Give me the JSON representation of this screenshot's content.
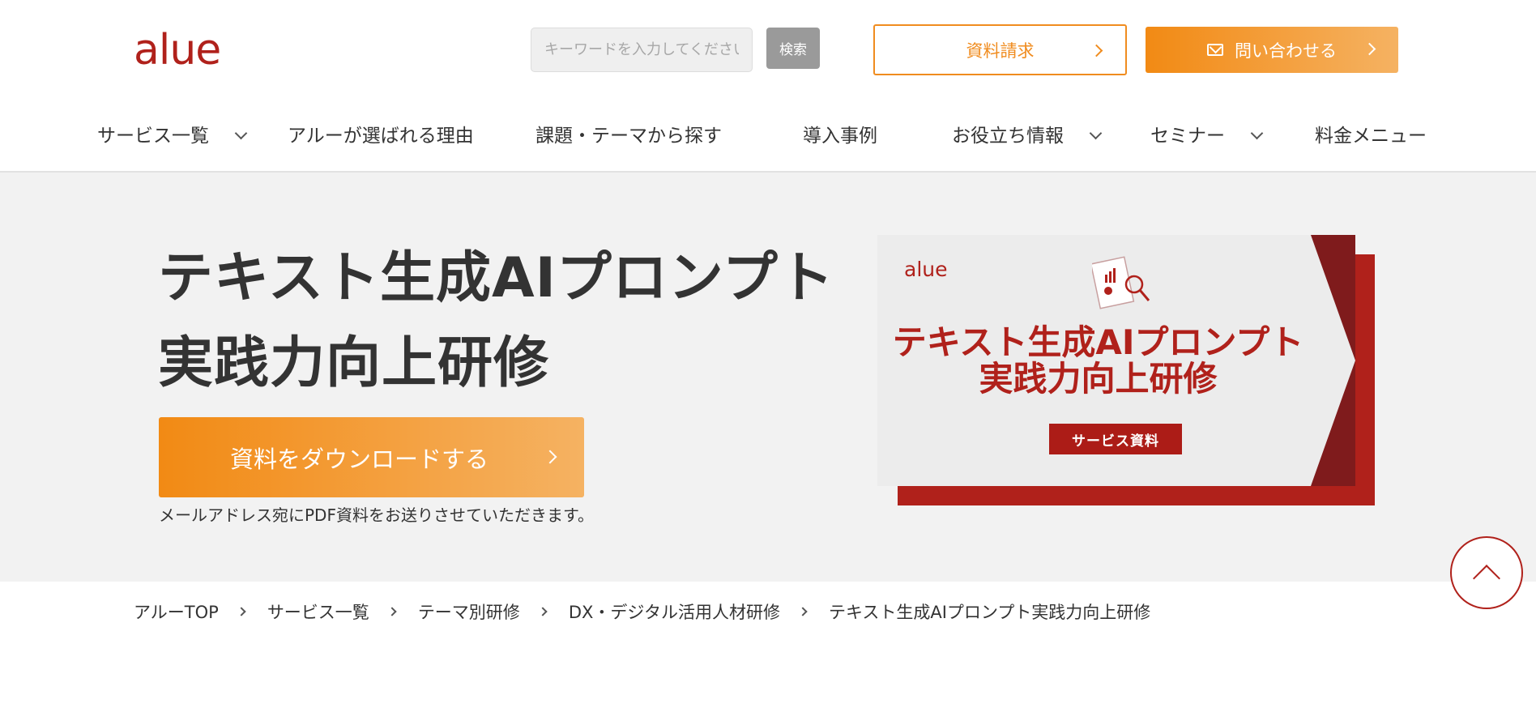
{
  "header": {
    "logo": "alue",
    "search_placeholder": "キーワードを入力してください",
    "search_button": "検索",
    "request_button": "資料請求",
    "contact_button": "問い合わせる"
  },
  "nav": {
    "items": [
      {
        "label": "サービス一覧",
        "has_dropdown": true
      },
      {
        "label": "アルーが選ばれる理由",
        "has_dropdown": false
      },
      {
        "label": "課題・テーマから探す",
        "has_dropdown": false
      },
      {
        "label": "導入事例",
        "has_dropdown": false
      },
      {
        "label": "お役立ち情報",
        "has_dropdown": true
      },
      {
        "label": "セミナー",
        "has_dropdown": true
      },
      {
        "label": "料金メニュー",
        "has_dropdown": false
      }
    ]
  },
  "hero": {
    "title_line1": "テキスト生成AIプロンプト",
    "title_line2": "実践力向上研修",
    "download_button": "資料をダウンロードする",
    "download_note": "メールアドレス宛にPDF資料をお送りさせていただきます。",
    "thumbnail": {
      "logo": "alue",
      "title_line1": "テキスト生成AIプロンプト",
      "title_line2": "実践力向上研修",
      "badge": "サービス資料"
    }
  },
  "breadcrumb": [
    "アルーTOP",
    "サービス一覧",
    "テーマ別研修",
    "DX・デジタル活用人材研修",
    "テキスト生成AIプロンプト実践力向上研修"
  ],
  "colors": {
    "brand_red": "#b0211b",
    "accent_orange": "#f08c1f",
    "hero_bg": "#f2f2f2"
  }
}
